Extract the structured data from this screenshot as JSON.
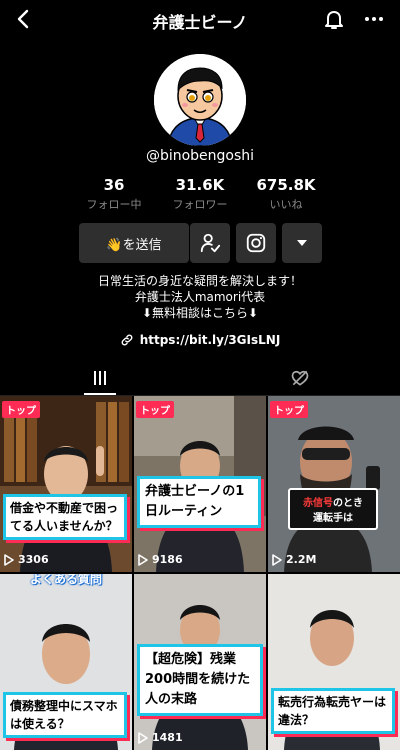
{
  "header": {
    "title": "弁護士ビーノ",
    "back_icon": "chevron-left-icon",
    "bell_icon": "bell-icon",
    "more_icon": "more-horizontal-icon"
  },
  "profile": {
    "username": "@binobengoshi",
    "stats": [
      {
        "value": "36",
        "label": "フォロー中"
      },
      {
        "value": "31.6K",
        "label": "フォロワー"
      },
      {
        "value": "675.8K",
        "label": "いいね"
      }
    ],
    "message_button": "👋を送信",
    "bio": [
      "日常生活の身近な疑問を解決します！",
      "弁護士法人mamori代表",
      "⬇無料相談はこちら⬇"
    ],
    "link": "https://bit.ly/3GIsLNJ"
  },
  "colors": {
    "accent_red": "#fe2c55",
    "caption_border": "#1fc5e6"
  },
  "videos": [
    {
      "badge": "トップ",
      "caption": "借金や不動産で困ってる人いませんか？",
      "views": "3306"
    },
    {
      "badge": "トップ",
      "caption": "弁護士ビーノの1日ルーティン",
      "views": "9186"
    },
    {
      "badge": "トップ",
      "caption_part1": "赤信号",
      "caption_part2": "のとき",
      "caption_part3": "運転手は",
      "views": "2.2M"
    },
    {
      "top_text": "よくある質問",
      "caption": "債務整理中にスマホは使える？",
      "views": ""
    },
    {
      "caption": "【超危険】残業200時間を続けた人の末路",
      "views": "1481"
    },
    {
      "caption": "転売行為転売ヤーは違法？",
      "views": ""
    }
  ]
}
